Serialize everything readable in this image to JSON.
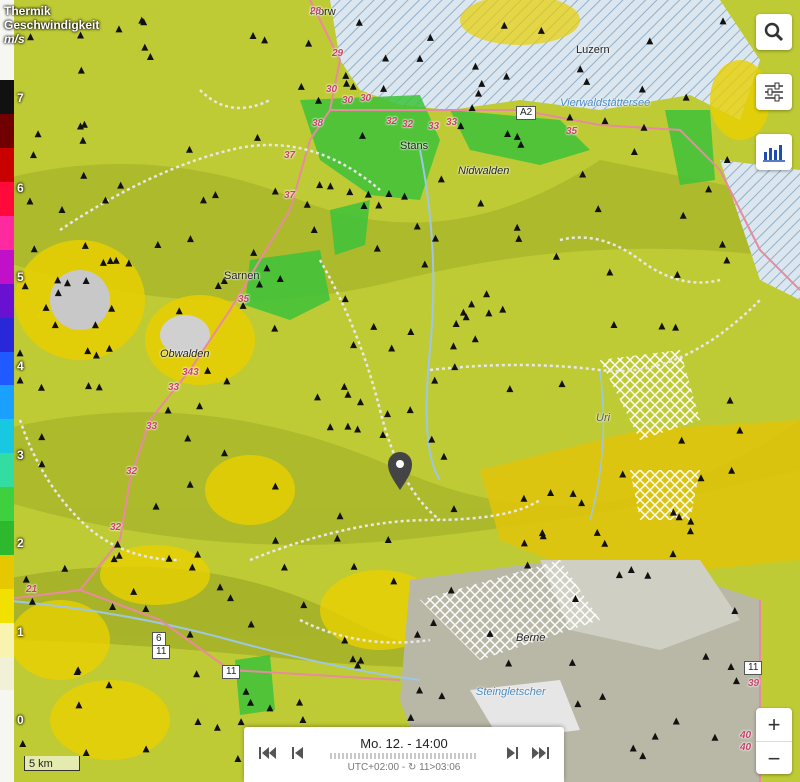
{
  "legend": {
    "title_line1": "Thermik",
    "title_line2": "Geschwindigkeit",
    "unit": "m/s",
    "ticks": [
      "7",
      "6",
      "5",
      "4",
      "3",
      "2",
      "1",
      "0"
    ],
    "colors": [
      "#f2f0d6",
      "#f8f4b0",
      "#f2e000",
      "#e6c800",
      "#2db82d",
      "#3fd03f",
      "#33dca0",
      "#18c8e0",
      "#1aa0ff",
      "#1e5aff",
      "#2828d8",
      "#6a10d0",
      "#c010c8",
      "#ff2aa0",
      "#ff0a3a",
      "#c80000",
      "#700000",
      "#111111"
    ]
  },
  "places": {
    "horw": "Horw",
    "luzern": "Luzern",
    "vierwaldstaettersee": "Vierwaldstättersee",
    "stans": "Stans",
    "nidwalden": "Nidwalden",
    "sarnen": "Sarnen",
    "obwalden": "Obwalden",
    "steingletscher": "Steingletscher",
    "berne": "Berne",
    "uri": "Uri"
  },
  "roads": [
    "28",
    "29",
    "30",
    "30",
    "30",
    "32",
    "32",
    "33",
    "33",
    "35",
    "38",
    "37",
    "37",
    "35",
    "343",
    "33",
    "33",
    "32",
    "32",
    "21",
    "40",
    "40",
    "39"
  ],
  "shields": {
    "a2": "A2",
    "r6": "6",
    "r11a": "11",
    "r11b": "11",
    "r11c": "11"
  },
  "timebar": {
    "date_time": "Mo. 12. - 14:00",
    "timezone": "UTC+02:00 - ",
    "updated": "11>03:06"
  },
  "scale": "5 km",
  "icons": {
    "search": "search-icon",
    "settings": "sliders-icon",
    "chart": "bar-chart-icon",
    "pin": "map-pin-icon"
  },
  "zoom": {
    "in": "+",
    "out": "−"
  }
}
